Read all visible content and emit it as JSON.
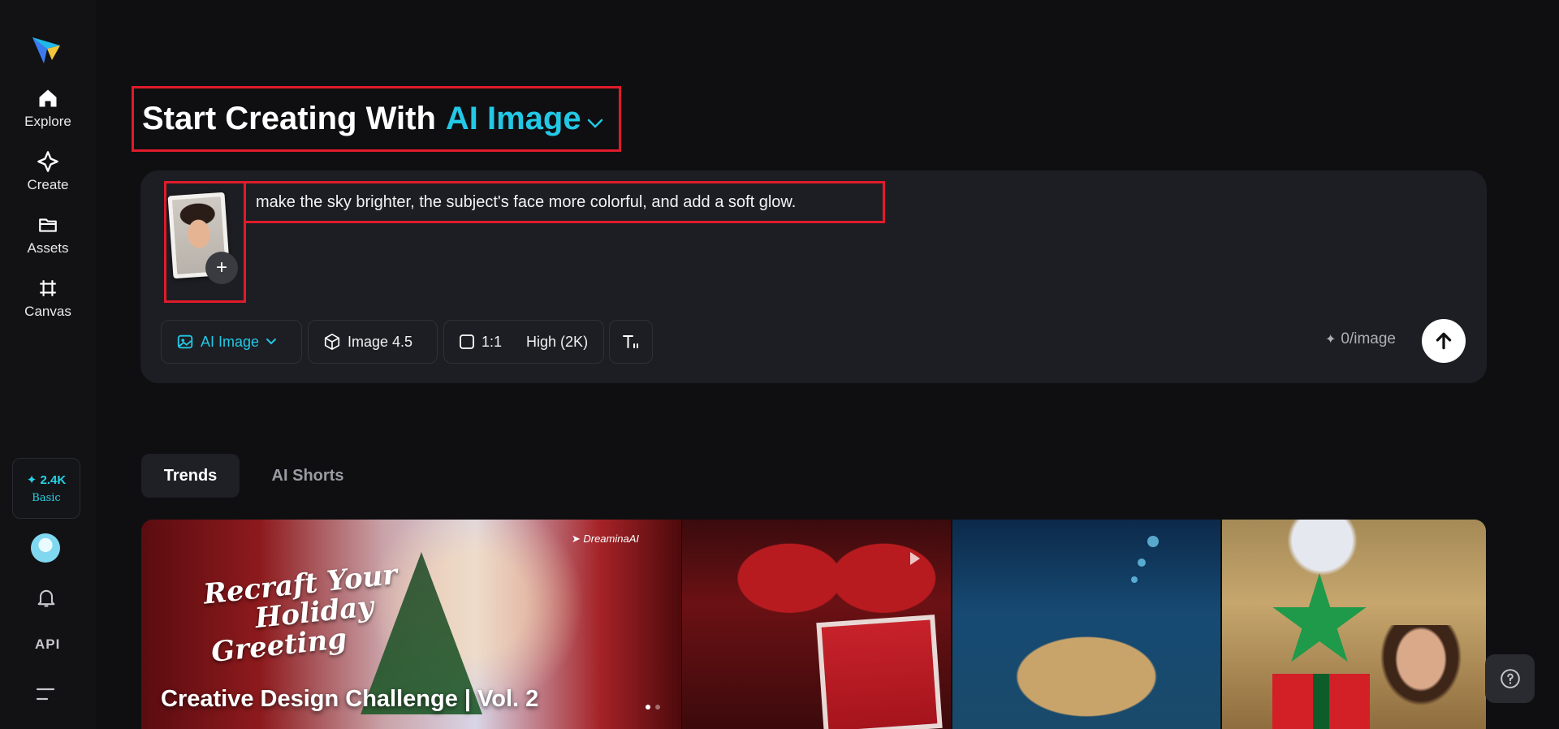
{
  "sidebar": {
    "nav": [
      {
        "label": "Explore",
        "icon": "home-icon"
      },
      {
        "label": "Create",
        "icon": "sparkle-diamond-icon"
      },
      {
        "label": "Assets",
        "icon": "folder-icon"
      },
      {
        "label": "Canvas",
        "icon": "grid-frame-icon"
      }
    ],
    "credits": {
      "amount": "2.4K",
      "plan": "Basic"
    },
    "api_label": "API"
  },
  "heading": {
    "prefix": "Start Creating With",
    "mode": "AI Image"
  },
  "prompt": {
    "text": "make the sky brighter, the subject's face more colorful, and add a soft glow.",
    "add_symbol": "+"
  },
  "toolbar": {
    "mode_label": "AI Image",
    "model_label": "Image 4.5",
    "ratio_label": "1:1",
    "quality_label": "High (2K)",
    "cost_label": "0/image"
  },
  "tabs": [
    {
      "label": "Trends",
      "active": true
    },
    {
      "label": "AI Shorts",
      "active": false
    }
  ],
  "gallery": {
    "featured": {
      "headline_lines": [
        "Recraft Your",
        "Holiday",
        "Greeting"
      ],
      "brand": "DreaminaAI",
      "title": "Creative Design Challenge | Vol. 2"
    }
  },
  "colors": {
    "accent": "#22c8e5",
    "highlight_border": "#e01b2b",
    "background": "#0f0f11",
    "panel": "#1d1e23"
  }
}
